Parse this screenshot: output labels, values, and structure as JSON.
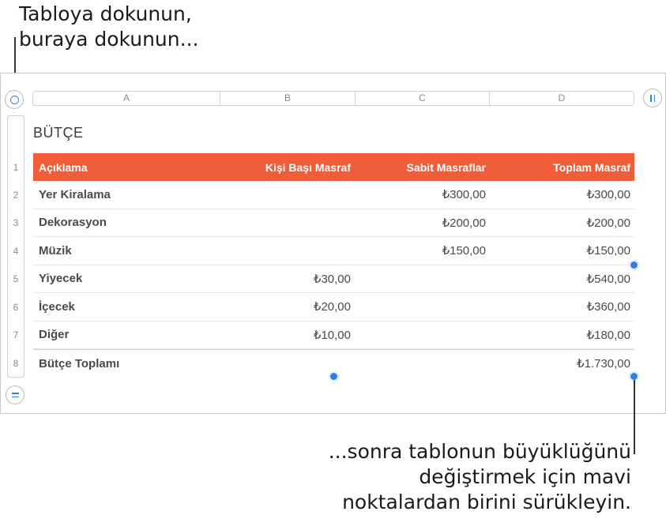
{
  "callouts": {
    "top": [
      "Tabloya dokunun,",
      "buraya dokunun..."
    ],
    "bottom": [
      "...sonra tablonun büyüklüğünü",
      "değiştirmek için mavi",
      "noktalardan birini sürükleyin."
    ]
  },
  "column_letters": [
    "A",
    "B",
    "C",
    "D"
  ],
  "row_numbers": [
    "1",
    "2",
    "3",
    "4",
    "5",
    "6",
    "7",
    "8"
  ],
  "table": {
    "title": "BÜTÇE",
    "header": [
      "Açıklama",
      "Kişi Başı Masraf",
      "Sabit Masraflar",
      "Toplam Masraf"
    ],
    "rows": [
      [
        "Yer Kiralama",
        "",
        "₺300,00",
        "₺300,00"
      ],
      [
        "Dekorasyon",
        "",
        "₺200,00",
        "₺200,00"
      ],
      [
        "Müzik",
        "",
        "₺150,00",
        "₺150,00"
      ],
      [
        "Yiyecek",
        "₺30,00",
        "",
        "₺540,00"
      ],
      [
        "İçecek",
        "₺20,00",
        "",
        "₺360,00"
      ],
      [
        "Diğer",
        "₺10,00",
        "",
        "₺180,00"
      ]
    ],
    "footer": [
      "Bütçe Toplamı",
      "",
      "",
      "₺1.730,00"
    ]
  },
  "colors": {
    "header_fill": "#f05d39",
    "handle_blue": "#2f7fdc"
  }
}
